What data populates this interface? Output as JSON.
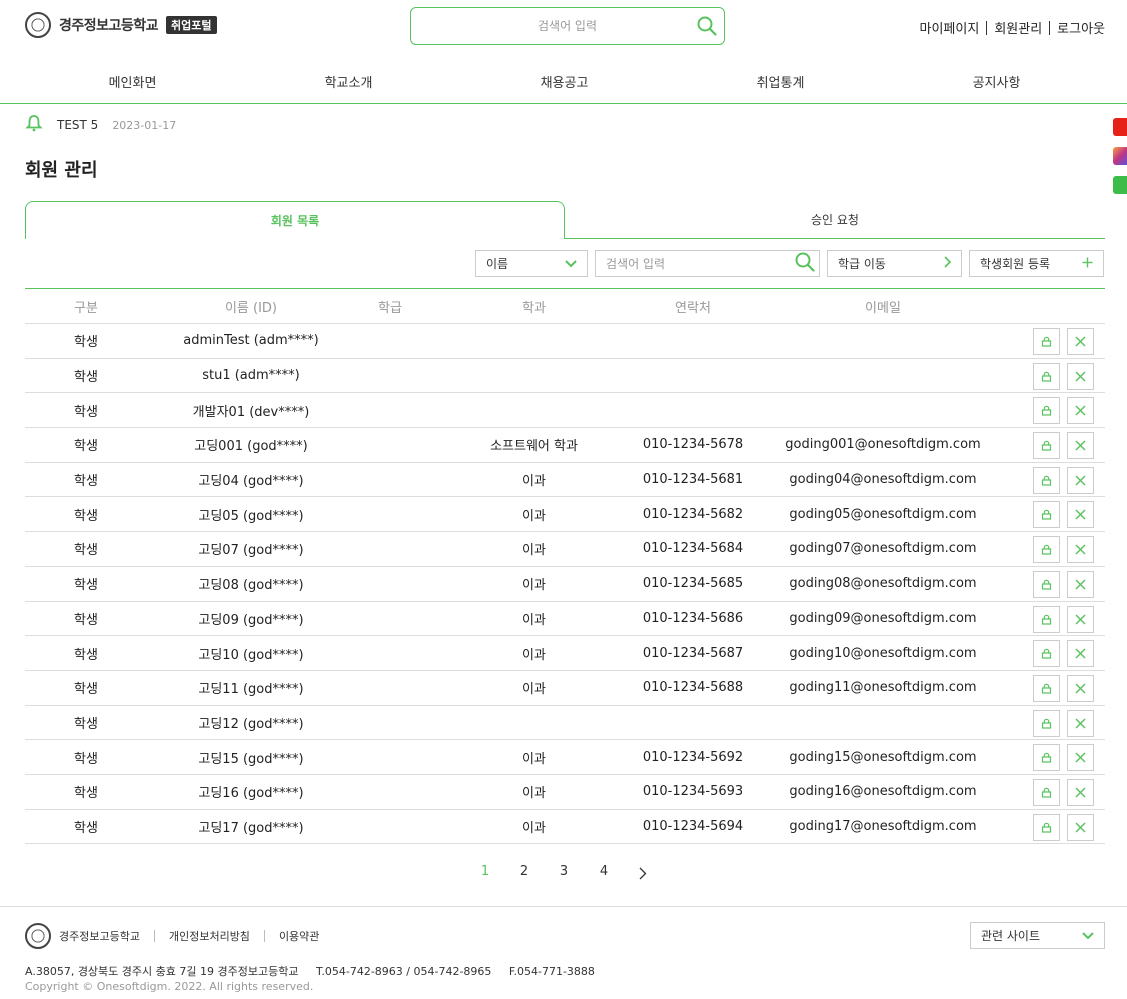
{
  "header": {
    "school_name": "경주정보고등학교",
    "badge": "취업포털",
    "search_placeholder": "검색어 입력",
    "user_menu": [
      "마이페이지",
      "회원관리",
      "로그아웃"
    ],
    "nav": [
      "메인화면",
      "학교소개",
      "채용공고",
      "취업통계",
      "공지사항"
    ]
  },
  "notice": {
    "title": "TEST 5",
    "date": "2023-01-17"
  },
  "page_title": "회원 관리",
  "tabs": {
    "active": "회원 목록",
    "inactive": "승인 요청"
  },
  "toolbar": {
    "filter_select": "이름",
    "search_placeholder": "검색어 입력",
    "grade_move": "학급 이동",
    "register": "학생회원 등록"
  },
  "table": {
    "headers": [
      "구분",
      "이름 (ID)",
      "학급",
      "학과",
      "연락처",
      "이메일"
    ],
    "rows": [
      {
        "type": "학생",
        "name": "adminTest (adm****)",
        "grade": "",
        "dept": "",
        "phone": "",
        "email": ""
      },
      {
        "type": "학생",
        "name": "stu1 (adm****)",
        "grade": "",
        "dept": "",
        "phone": "",
        "email": ""
      },
      {
        "type": "학생",
        "name": "개발자01 (dev****)",
        "grade": "",
        "dept": "",
        "phone": "",
        "email": ""
      },
      {
        "type": "학생",
        "name": "고딩001 (god****)",
        "grade": "",
        "dept": "소프트웨어 학과",
        "phone": "010-1234-5678",
        "email": "goding001@onesoftdigm.com"
      },
      {
        "type": "학생",
        "name": "고딩04 (god****)",
        "grade": "",
        "dept": "이과",
        "phone": "010-1234-5681",
        "email": "goding04@onesoftdigm.com"
      },
      {
        "type": "학생",
        "name": "고딩05 (god****)",
        "grade": "",
        "dept": "이과",
        "phone": "010-1234-5682",
        "email": "goding05@onesoftdigm.com"
      },
      {
        "type": "학생",
        "name": "고딩07 (god****)",
        "grade": "",
        "dept": "이과",
        "phone": "010-1234-5684",
        "email": "goding07@onesoftdigm.com"
      },
      {
        "type": "학생",
        "name": "고딩08 (god****)",
        "grade": "",
        "dept": "이과",
        "phone": "010-1234-5685",
        "email": "goding08@onesoftdigm.com"
      },
      {
        "type": "학생",
        "name": "고딩09 (god****)",
        "grade": "",
        "dept": "이과",
        "phone": "010-1234-5686",
        "email": "goding09@onesoftdigm.com"
      },
      {
        "type": "학생",
        "name": "고딩10 (god****)",
        "grade": "",
        "dept": "이과",
        "phone": "010-1234-5687",
        "email": "goding10@onesoftdigm.com"
      },
      {
        "type": "학생",
        "name": "고딩11 (god****)",
        "grade": "",
        "dept": "이과",
        "phone": "010-1234-5688",
        "email": "goding11@onesoftdigm.com"
      },
      {
        "type": "학생",
        "name": "고딩12 (god****)",
        "grade": "",
        "dept": "",
        "phone": "",
        "email": ""
      },
      {
        "type": "학생",
        "name": "고딩15 (god****)",
        "grade": "",
        "dept": "이과",
        "phone": "010-1234-5692",
        "email": "goding15@onesoftdigm.com"
      },
      {
        "type": "학생",
        "name": "고딩16 (god****)",
        "grade": "",
        "dept": "이과",
        "phone": "010-1234-5693",
        "email": "goding16@onesoftdigm.com"
      },
      {
        "type": "학생",
        "name": "고딩17 (god****)",
        "grade": "",
        "dept": "이과",
        "phone": "010-1234-5694",
        "email": "goding17@onesoftdigm.com"
      }
    ]
  },
  "pagination": {
    "pages": [
      "1",
      "2",
      "3",
      "4"
    ],
    "current": "1",
    "next_icon": "chevron-right-icon"
  },
  "footer": {
    "school_name": "경주정보고등학교",
    "links": [
      "개인정보처리방침",
      "이용약관"
    ],
    "related_site": "관련 사이트",
    "address": "A.38057, 경상북도 경주시 충효 7길 19 경주정보고등학교",
    "tel": "T.054-742-8963 / 054-742-8965",
    "fax": "F.054-771-3888",
    "copyright": "Copyright © Onesoftdigm. 2022. All rights reserved."
  },
  "colors": {
    "accent": "#58c25f",
    "youtube": "#e62117",
    "instagram": "#c13584",
    "blog": "#3dbc4a"
  },
  "icons": [
    "school-emblem-icon",
    "search-icon",
    "bell-icon",
    "chevron-down-icon",
    "chevron-right-icon",
    "plus-icon",
    "lock-icon",
    "close-icon",
    "youtube-icon",
    "instagram-icon",
    "blog-icon"
  ]
}
